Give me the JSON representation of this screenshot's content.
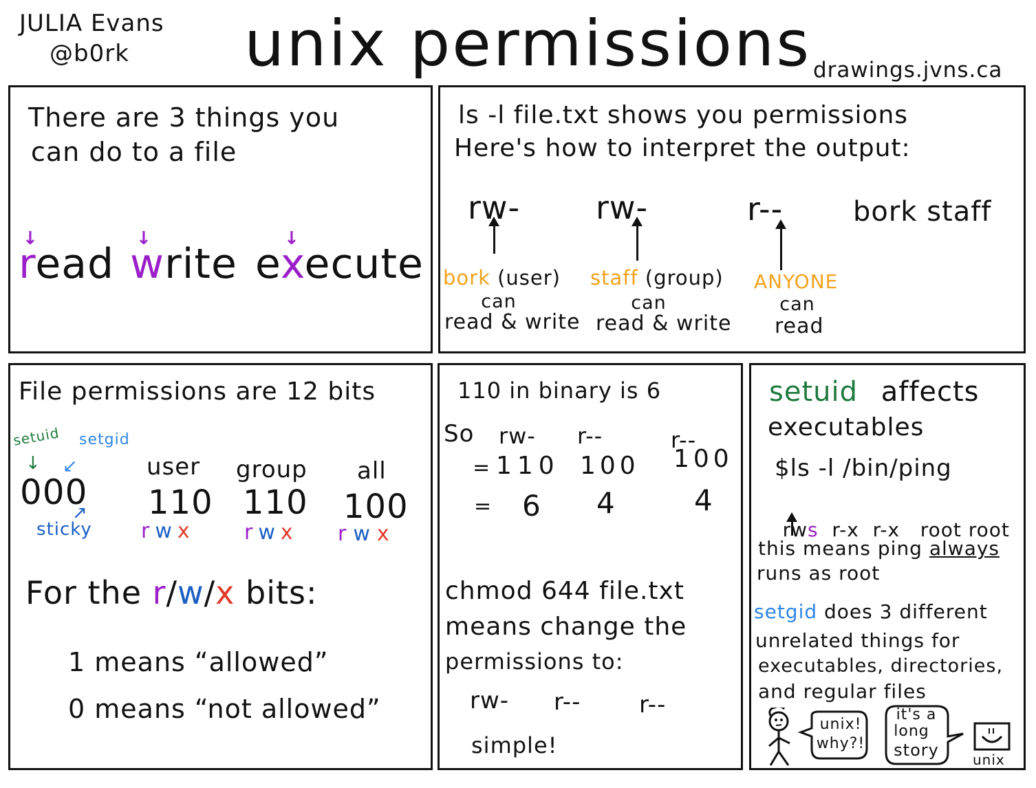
{
  "header": {
    "author": "JULIA Evans",
    "handle": "@b0rk",
    "title": "unix permissions",
    "site": "drawings.jvns.ca"
  },
  "panel_things": {
    "line1": "There are 3 things you",
    "line2": "can do to a file",
    "words": [
      {
        "hl": "r",
        "rest": "ead",
        "pre": ""
      },
      {
        "hl": "w",
        "rest": "rite",
        "pre": ""
      },
      {
        "hl": "x",
        "rest": "ecute",
        "pre": "e"
      }
    ],
    "arrow_glyph": "↓"
  },
  "panel_ls": {
    "line1": "ls -l file.txt shows you permissions",
    "line2": "Here's how to interpret the output:",
    "groups": [
      {
        "perm": "rw-",
        "who": "bork",
        "role": " (user)",
        "can": "can",
        "what": "read & write"
      },
      {
        "perm": "rw-",
        "who": "staff",
        "role": " (group)",
        "can": "can",
        "what": "read & write"
      },
      {
        "perm": "r--",
        "who": "ANYONE",
        "role": "",
        "can": "can",
        "what": "read"
      }
    ],
    "owners": "bork staff"
  },
  "panel_bits": {
    "title": "File permissions are 12 bits",
    "setuid_label": "setuid",
    "setgid_label": "setgid",
    "sticky_label": "sticky",
    "special_bits": "000",
    "columns": [
      {
        "label": "user",
        "bits": "110"
      },
      {
        "label": "group",
        "bits": "110"
      },
      {
        "label": "all",
        "bits": "100"
      }
    ],
    "rwx": {
      "r": "r",
      "w": "w",
      "x": "x"
    },
    "for_the": "For the",
    "bits_suffix": "bits:",
    "slash": "/",
    "one_means": "1 means “allowed”",
    "zero_means": "0 means “not allowed”"
  },
  "panel_binary": {
    "line1": "110 in binary is 6",
    "so": "So",
    "perms": [
      "rw-",
      "r--",
      "r--"
    ],
    "binary": [
      "110",
      "100",
      "100"
    ],
    "decimal": [
      "6",
      "4",
      "4"
    ],
    "eq": "=",
    "chmod_line1": "chmod 644 file.txt",
    "chmod_line2": "means change the",
    "chmod_line3": "permissions to:",
    "result_perms": [
      "rw-",
      "r--",
      "r--"
    ],
    "simple": "simple!"
  },
  "panel_setuid": {
    "setuid_word": "setuid",
    "affects": "affects",
    "executables": "executables",
    "command": "$ls -l /bin/ping",
    "out_prefix": "rw",
    "out_s": "s",
    "out_rest": "  r-x  r-x   root root",
    "means1_pre": "this means ping ",
    "means1_ul": "always",
    "means2": "runs as root",
    "setgid_word": "setgid",
    "setgid_rest": " does 3 different",
    "setgid2": "unrelated things for",
    "setgid3": "executables, directories,",
    "setgid4": "and regular files",
    "bubble1_l1": "unix!",
    "bubble1_l2": "why?!",
    "bubble2_l1": "it's a",
    "bubble2_l2": "long",
    "bubble2_l3": "story",
    "computer_label": "unix"
  }
}
